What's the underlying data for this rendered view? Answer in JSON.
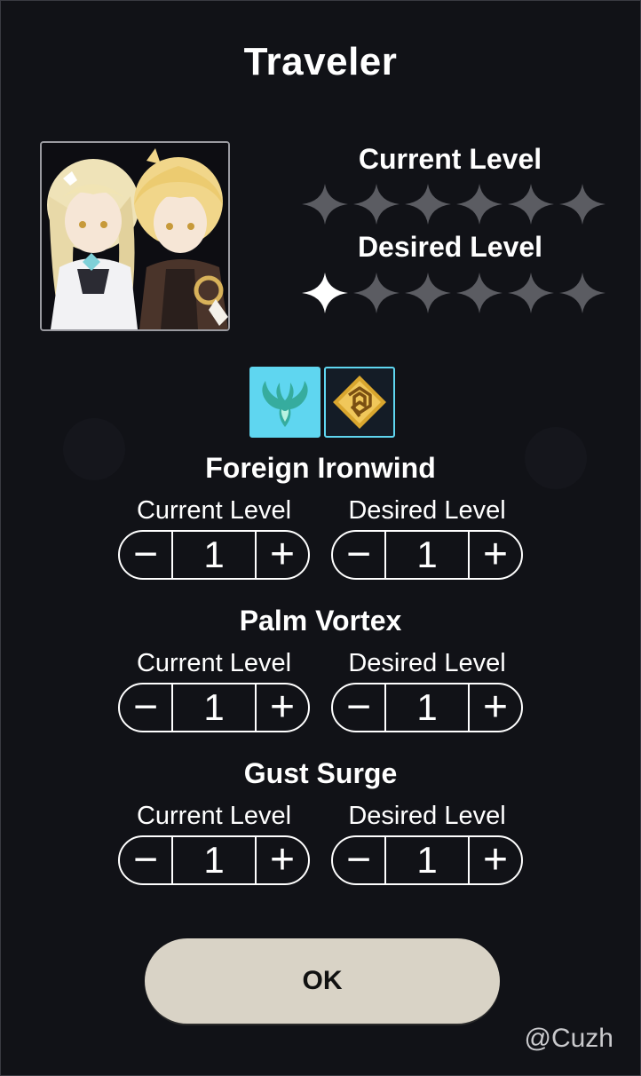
{
  "dialog": {
    "title": "Traveler",
    "current_level_heading": "Current Level",
    "desired_level_heading": "Desired Level",
    "current_stars": {
      "total": 6,
      "filled": 0
    },
    "desired_stars": {
      "total": 6,
      "filled": 1
    },
    "elements": [
      {
        "name": "Anemo",
        "icon": "anemo-emblem-icon",
        "selected": true,
        "color": "#5fd6f0"
      },
      {
        "name": "Geo",
        "icon": "geo-emblem-icon",
        "selected": false,
        "color": "#e6b53c"
      }
    ],
    "talents": [
      {
        "name": "Foreign Ironwind",
        "current_label": "Current Level",
        "desired_label": "Desired Level",
        "current": "1",
        "desired": "1"
      },
      {
        "name": "Palm Vortex",
        "current_label": "Current Level",
        "desired_label": "Desired Level",
        "current": "1",
        "desired": "1"
      },
      {
        "name": "Gust Surge",
        "current_label": "Current Level",
        "desired_label": "Desired Level",
        "current": "1",
        "desired": "1"
      }
    ],
    "stepper_minus": "−",
    "stepper_plus": "+",
    "ok_label": "OK"
  },
  "watermark": "@Cuzh",
  "colors": {
    "background": "#111217",
    "star_empty": "#5b5c62",
    "star_filled": "#ffffff",
    "ok_button": "#d9d3c6",
    "element_highlight": "#5fd6f0"
  }
}
